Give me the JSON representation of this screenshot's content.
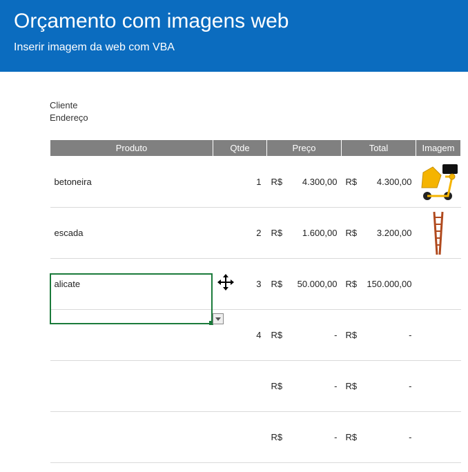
{
  "header": {
    "title": "Orçamento com imagens web",
    "subtitle": "Inserir imagem da web com VBA"
  },
  "info": {
    "cliente_label": "Cliente",
    "endereco_label": "Endereço"
  },
  "columns": {
    "produto": "Produto",
    "qtde": "Qtde",
    "preco": "Preço",
    "total": "Total",
    "imagem": "Imagem"
  },
  "currency": "R$",
  "rows": [
    {
      "produto": "betoneira",
      "qtde": "1",
      "preco": "4.300,00",
      "total": "4.300,00",
      "img": "mixer"
    },
    {
      "produto": "escada",
      "qtde": "2",
      "preco": "1.600,00",
      "total": "3.200,00",
      "img": "ladder"
    },
    {
      "produto": "alicate",
      "qtde": "3",
      "preco": "50.000,00",
      "total": "150.000,00",
      "img": ""
    },
    {
      "produto": "",
      "qtde": "4",
      "preco": "-",
      "total": "-",
      "img": ""
    },
    {
      "produto": "",
      "qtde": "",
      "preco": "-",
      "total": "-",
      "img": ""
    },
    {
      "produto": "",
      "qtde": "",
      "preco": "-",
      "total": "-",
      "img": ""
    }
  ]
}
